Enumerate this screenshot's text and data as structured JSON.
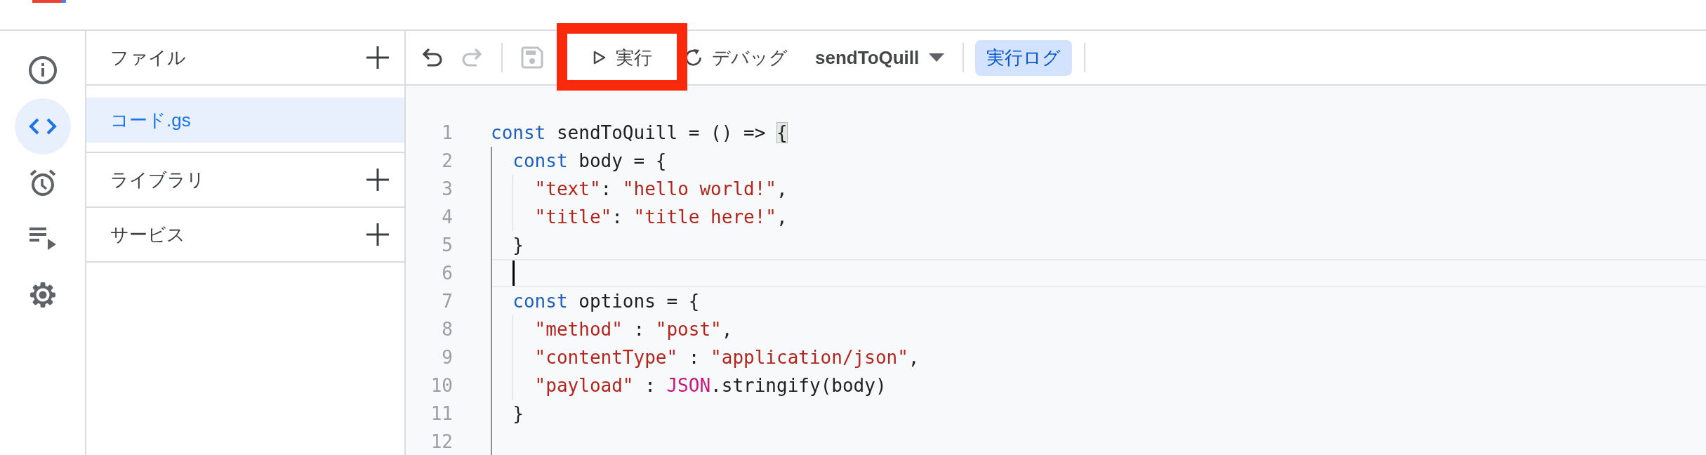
{
  "rail": [
    {
      "selected": false
    },
    {
      "selected": true
    },
    {
      "selected": false
    },
    {
      "selected": false
    },
    {
      "selected": false
    }
  ],
  "files_panel": {
    "sections": [
      {
        "title": "ファイル",
        "files": [
          {
            "name": "コード.gs",
            "selected": true
          }
        ]
      },
      {
        "title": "ライブラリ"
      },
      {
        "title": "サービス"
      }
    ]
  },
  "toolbar": {
    "undo": {
      "disabled": false
    },
    "redo": {
      "disabled": true
    },
    "save": {
      "disabled": true
    },
    "run": {
      "label": "実行",
      "highlighted": true
    },
    "debug": {
      "label": "デバッグ"
    },
    "function_select": {
      "value": "sendToQuill"
    },
    "log_button": {
      "label": "実行ログ",
      "on": true
    }
  },
  "editor": {
    "lines": [
      {
        "number": "1",
        "current": false,
        "tokens": [
          {
            "kind": "keyword",
            "text": "const"
          },
          {
            "kind": "plain",
            "text": " sendToQuill = () => "
          },
          {
            "kind": "bracket",
            "text": "{"
          }
        ]
      },
      {
        "number": "2",
        "current": false,
        "tokens": [
          {
            "kind": "keyword",
            "text": "  const"
          },
          {
            "kind": "plain",
            "text": " body = {"
          }
        ]
      },
      {
        "number": "3",
        "current": false,
        "tokens": [
          {
            "kind": "string",
            "text": "    \"text\""
          },
          {
            "kind": "plain",
            "text": ": "
          },
          {
            "kind": "string",
            "text": "\"hello world!\""
          },
          {
            "kind": "plain",
            "text": ","
          }
        ]
      },
      {
        "number": "4",
        "current": false,
        "tokens": [
          {
            "kind": "string",
            "text": "    \"title\""
          },
          {
            "kind": "plain",
            "text": ": "
          },
          {
            "kind": "string",
            "text": "\"title here!\""
          },
          {
            "kind": "plain",
            "text": ","
          }
        ]
      },
      {
        "number": "5",
        "current": false,
        "tokens": [
          {
            "kind": "plain",
            "text": "  }"
          }
        ]
      },
      {
        "number": "6",
        "current": true
      },
      {
        "number": "7",
        "current": false,
        "tokens": [
          {
            "kind": "keyword",
            "text": "  const"
          },
          {
            "kind": "plain",
            "text": " options = {"
          }
        ]
      },
      {
        "number": "8",
        "current": false,
        "tokens": [
          {
            "kind": "string",
            "text": "    \"method\""
          },
          {
            "kind": "plain",
            "text": " : "
          },
          {
            "kind": "string",
            "text": "\"post\""
          },
          {
            "kind": "plain",
            "text": ","
          }
        ]
      },
      {
        "number": "9",
        "current": false,
        "tokens": [
          {
            "kind": "string",
            "text": "    \"contentType\""
          },
          {
            "kind": "plain",
            "text": " : "
          },
          {
            "kind": "string",
            "text": "\"application/json\""
          },
          {
            "kind": "plain",
            "text": ","
          }
        ]
      },
      {
        "number": "10",
        "current": false,
        "tokens": [
          {
            "kind": "string",
            "text": "    \"payload\""
          },
          {
            "kind": "plain",
            "text": " : "
          },
          {
            "kind": "builtin",
            "text": "JSON"
          },
          {
            "kind": "plain",
            "text": ".stringify(body)"
          }
        ]
      },
      {
        "number": "11",
        "current": false,
        "tokens": [
          {
            "kind": "plain",
            "text": "  }"
          }
        ]
      },
      {
        "number": "12",
        "current": false
      }
    ]
  }
}
